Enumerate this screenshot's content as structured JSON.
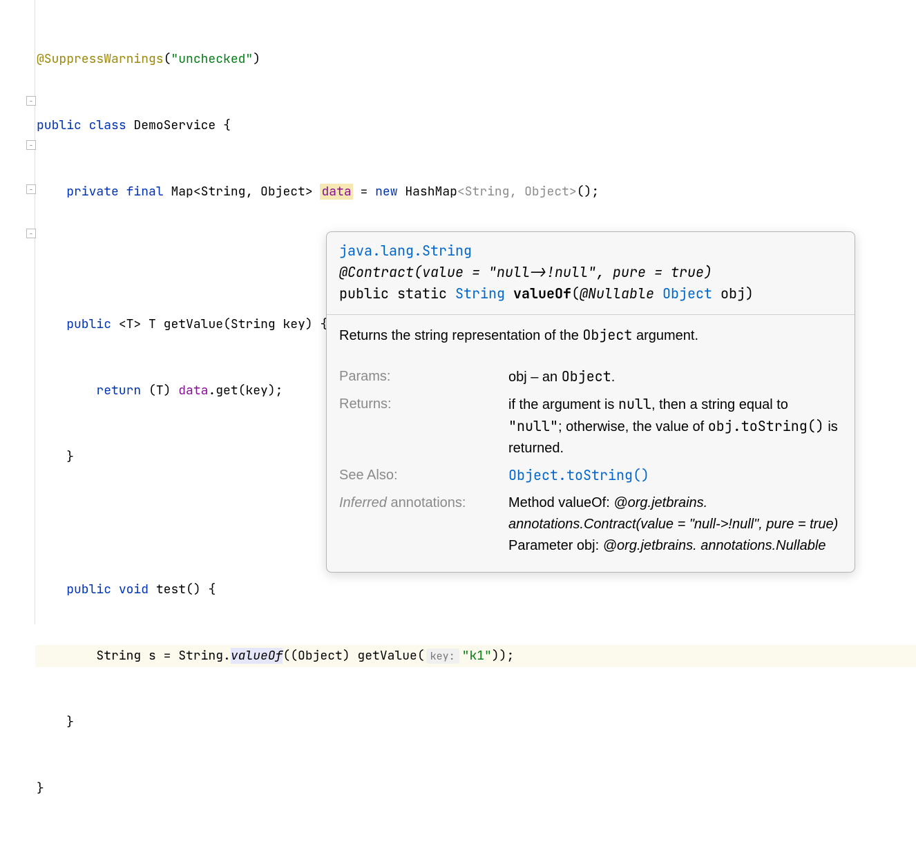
{
  "code": {
    "l1": {
      "ann": "@SuppressWarnings",
      "str": "\"unchecked\"",
      "close": ")"
    },
    "l2": {
      "kw1": "public",
      "kw2": "class",
      "name": "DemoService",
      "brace": "{"
    },
    "l3": {
      "kw1": "private",
      "kw2": "final",
      "type": "Map",
      "gen1": "<String, Object>",
      "field": "data",
      "eq": "=",
      "kw3": "new",
      "ctor": "HashMap",
      "gen2": "<String, Object>",
      "tail": "();"
    },
    "l5": {
      "kw1": "public",
      "gen": "<T>",
      "ret": "T",
      "name": "getValue",
      "params": "(String key) {"
    },
    "l6": {
      "kw": "return",
      "cast": "(T)",
      "field": "data",
      "tail": ".get(key);"
    },
    "l7": {
      "brace": "}"
    },
    "l9": {
      "kw1": "public",
      "kw2": "void",
      "name": "test",
      "params": "() {"
    },
    "l10": {
      "pre": "String s = String.",
      "method": "valueOf",
      "open": "((Object) getValue(",
      "hint": "key:",
      "str": "\"k1\"",
      "close": "));"
    },
    "l11": {
      "brace": "}"
    },
    "l12": {
      "brace": "}"
    }
  },
  "tooltip": {
    "package": "java.lang.String",
    "contract": "@Contract(value = \"null->!null\", pure = true)",
    "sig_kw": "public static ",
    "sig_ret": "String",
    "sig_name": "valueOf",
    "sig_nullable": "@Nullable",
    "sig_paramtype": "Object",
    "sig_paramname": " obj)",
    "desc_pre": "Returns the string representation of the ",
    "desc_obj": "Object",
    "desc_post": " argument.",
    "params_label": "Params:",
    "params_val_pre": "obj – an ",
    "params_val_obj": "Object",
    "params_val_post": ".",
    "returns_label": "Returns:",
    "returns_val_a": "if the argument is ",
    "returns_val_null1": "null",
    "returns_val_b": ", then a string equal to ",
    "returns_val_null2": "\"null\"",
    "returns_val_c": "; otherwise, the value of ",
    "returns_val_tostr": "obj.toString()",
    "returns_val_d": " is returned.",
    "see_label": "See Also:",
    "see_val": "Object.toString()",
    "inferred_label_italic": "Inferred",
    "inferred_label_rest": " annotations:",
    "inferred_m_pre": "Method valueOf: ",
    "inferred_m_ann": "@org.jetbrains. annotations.Contract(value = \"null->!null\", pure = true)",
    "inferred_p_pre": "Parameter obj: ",
    "inferred_p_ann": "@org.jetbrains. annotations.Nullable"
  }
}
